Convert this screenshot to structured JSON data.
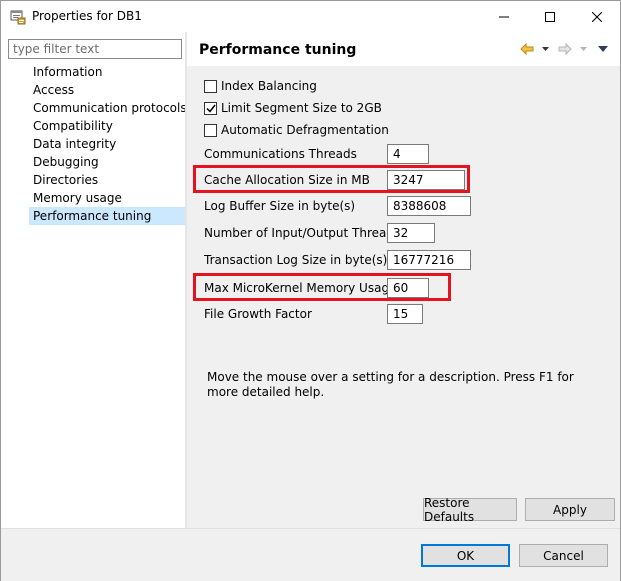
{
  "window": {
    "title": "Properties for DB1"
  },
  "sidebar": {
    "filter_placeholder": "type filter text",
    "items": [
      {
        "label": "Information"
      },
      {
        "label": "Access"
      },
      {
        "label": "Communication protocols"
      },
      {
        "label": "Compatibility"
      },
      {
        "label": "Data integrity"
      },
      {
        "label": "Debugging"
      },
      {
        "label": "Directories"
      },
      {
        "label": "Memory usage"
      },
      {
        "label": "Performance tuning",
        "selected": true
      }
    ]
  },
  "page": {
    "title": "Performance tuning",
    "checkboxes": [
      {
        "label": "Index Balancing",
        "checked": false
      },
      {
        "label": "Limit Segment Size to 2GB",
        "checked": true
      },
      {
        "label": "Automatic Defragmentation",
        "checked": false
      }
    ],
    "fields": [
      {
        "label": "Communications Threads",
        "value": "4"
      },
      {
        "label": "Cache Allocation Size in MB",
        "value": "3247",
        "highlighted": true
      },
      {
        "label": "Log Buffer Size in byte(s)",
        "value": "8388608"
      },
      {
        "label": "Number of Input/Output Threads",
        "value": "32"
      },
      {
        "label": "Transaction Log Size in byte(s)",
        "value": "16777216"
      },
      {
        "label": "Max MicroKernel Memory Usage",
        "value": "60",
        "highlighted": true
      },
      {
        "label": "File Growth Factor",
        "value": "15"
      }
    ],
    "description": "Move the mouse over a setting for a description. Press F1 for more detailed help.",
    "restore_defaults_label": "Restore Defaults",
    "apply_label": "Apply"
  },
  "footer": {
    "ok_label": "OK",
    "cancel_label": "Cancel"
  },
  "colors": {
    "highlight_box": "#e3131f",
    "selection": "#cce8ff",
    "nav_arrow": "#e6a817",
    "default_button_border": "#0078d7"
  },
  "icons": {
    "app": "properties-icon",
    "back": "back-arrow-icon",
    "forward": "forward-arrow-icon",
    "menu": "view-menu-icon"
  }
}
